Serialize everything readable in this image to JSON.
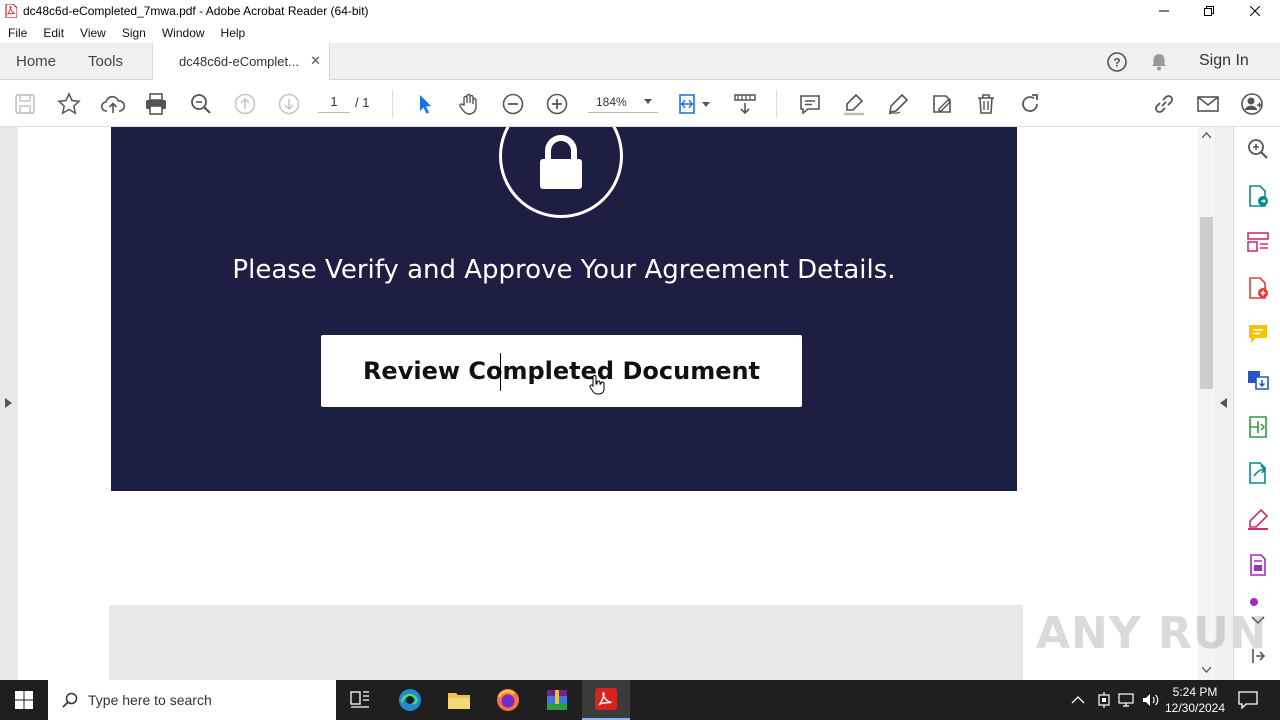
{
  "window": {
    "title": "dc48c6d-eCompleted_7mwa.pdf - Adobe Acrobat Reader (64-bit)"
  },
  "menu": [
    "File",
    "Edit",
    "View",
    "Sign",
    "Window",
    "Help"
  ],
  "tabs": {
    "home": "Home",
    "tools": "Tools",
    "document": "dc48c6d-eComplet...",
    "sign_in": "Sign In"
  },
  "toolbar": {
    "page_current": "1",
    "page_total": "/ 1",
    "zoom": "184%"
  },
  "document": {
    "headline": "Please Verify and Approve Your Agreement Details.",
    "button_label": "Review Completed Document",
    "banner_color": "#1d1f42"
  },
  "watermark": "ANY RUN",
  "taskbar": {
    "search_placeholder": "Type here to search",
    "time": "5:24 PM",
    "date": "12/30/2024"
  }
}
